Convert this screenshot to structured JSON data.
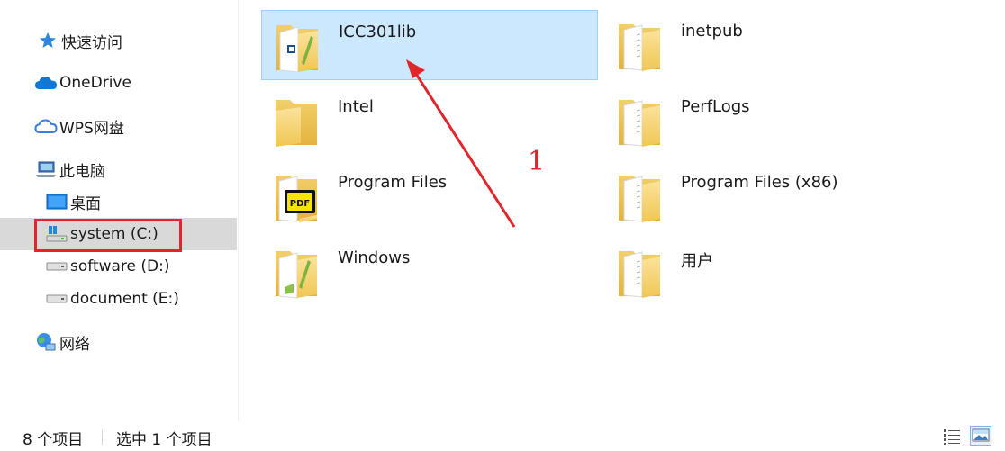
{
  "nav": {
    "quick_access": "快速访问",
    "onedrive": "OneDrive",
    "wps": "WPS网盘",
    "this_pc": "此电脑",
    "desktop": "桌面",
    "drive_c": "system (C:)",
    "drive_d": "software (D:)",
    "drive_e": "document (E:)",
    "network": "网络"
  },
  "files": [
    {
      "name": "ICC301lib",
      "icon": "folder-app-icon"
    },
    {
      "name": "inetpub",
      "icon": "folder-doc-icon"
    },
    {
      "name": "Intel",
      "icon": "folder-icon"
    },
    {
      "name": "PerfLogs",
      "icon": "folder-doc-icon"
    },
    {
      "name": "Program Files",
      "icon": "folder-pdf-icon"
    },
    {
      "name": "Program Files (x86)",
      "icon": "folder-doc-icon"
    },
    {
      "name": "Windows",
      "icon": "folder-app-icon"
    },
    {
      "name": "用户",
      "icon": "folder-doc-icon"
    }
  ],
  "annotation": {
    "label": "1",
    "color": "#e0262b"
  },
  "status": {
    "count": "8 个项目",
    "selected": "选中 1 个项目"
  },
  "colors": {
    "selection_bg": "#cce8ff",
    "nav_selected_bg": "#d9d9d9",
    "folder_yellow": "#f8d775"
  }
}
